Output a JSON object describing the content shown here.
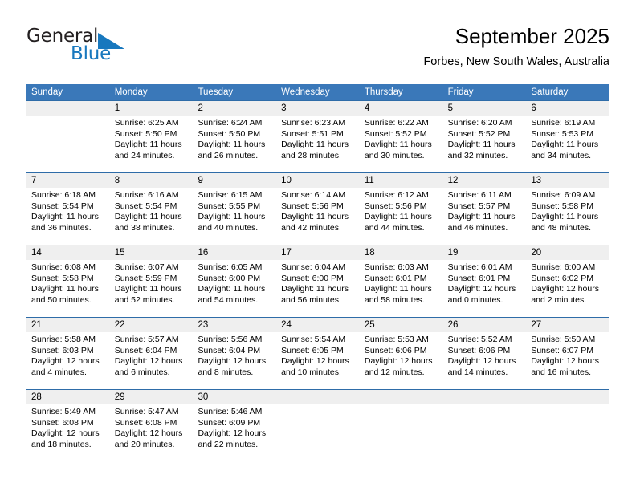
{
  "brand": {
    "name_top": "General",
    "name_bottom": "Blue",
    "accent_color": "#1878be",
    "dark_color": "#231f20"
  },
  "header": {
    "title": "September 2025",
    "subtitle": "Forbes, New South Wales, Australia"
  },
  "theme": {
    "header_blue": "#3a78b9",
    "row_rule_blue": "#2e6ca8",
    "day_band_gray": "#efefef"
  },
  "calendar": {
    "weekdays": [
      "Sunday",
      "Monday",
      "Tuesday",
      "Wednesday",
      "Thursday",
      "Friday",
      "Saturday"
    ],
    "weeks": [
      [
        {
          "day": "",
          "empty": true
        },
        {
          "day": "1",
          "sunrise": "Sunrise: 6:25 AM",
          "sunset": "Sunset: 5:50 PM",
          "daylight1": "Daylight: 11 hours",
          "daylight2": "and 24 minutes."
        },
        {
          "day": "2",
          "sunrise": "Sunrise: 6:24 AM",
          "sunset": "Sunset: 5:50 PM",
          "daylight1": "Daylight: 11 hours",
          "daylight2": "and 26 minutes."
        },
        {
          "day": "3",
          "sunrise": "Sunrise: 6:23 AM",
          "sunset": "Sunset: 5:51 PM",
          "daylight1": "Daylight: 11 hours",
          "daylight2": "and 28 minutes."
        },
        {
          "day": "4",
          "sunrise": "Sunrise: 6:22 AM",
          "sunset": "Sunset: 5:52 PM",
          "daylight1": "Daylight: 11 hours",
          "daylight2": "and 30 minutes."
        },
        {
          "day": "5",
          "sunrise": "Sunrise: 6:20 AM",
          "sunset": "Sunset: 5:52 PM",
          "daylight1": "Daylight: 11 hours",
          "daylight2": "and 32 minutes."
        },
        {
          "day": "6",
          "sunrise": "Sunrise: 6:19 AM",
          "sunset": "Sunset: 5:53 PM",
          "daylight1": "Daylight: 11 hours",
          "daylight2": "and 34 minutes."
        }
      ],
      [
        {
          "day": "7",
          "sunrise": "Sunrise: 6:18 AM",
          "sunset": "Sunset: 5:54 PM",
          "daylight1": "Daylight: 11 hours",
          "daylight2": "and 36 minutes."
        },
        {
          "day": "8",
          "sunrise": "Sunrise: 6:16 AM",
          "sunset": "Sunset: 5:54 PM",
          "daylight1": "Daylight: 11 hours",
          "daylight2": "and 38 minutes."
        },
        {
          "day": "9",
          "sunrise": "Sunrise: 6:15 AM",
          "sunset": "Sunset: 5:55 PM",
          "daylight1": "Daylight: 11 hours",
          "daylight2": "and 40 minutes."
        },
        {
          "day": "10",
          "sunrise": "Sunrise: 6:14 AM",
          "sunset": "Sunset: 5:56 PM",
          "daylight1": "Daylight: 11 hours",
          "daylight2": "and 42 minutes."
        },
        {
          "day": "11",
          "sunrise": "Sunrise: 6:12 AM",
          "sunset": "Sunset: 5:56 PM",
          "daylight1": "Daylight: 11 hours",
          "daylight2": "and 44 minutes."
        },
        {
          "day": "12",
          "sunrise": "Sunrise: 6:11 AM",
          "sunset": "Sunset: 5:57 PM",
          "daylight1": "Daylight: 11 hours",
          "daylight2": "and 46 minutes."
        },
        {
          "day": "13",
          "sunrise": "Sunrise: 6:09 AM",
          "sunset": "Sunset: 5:58 PM",
          "daylight1": "Daylight: 11 hours",
          "daylight2": "and 48 minutes."
        }
      ],
      [
        {
          "day": "14",
          "sunrise": "Sunrise: 6:08 AM",
          "sunset": "Sunset: 5:58 PM",
          "daylight1": "Daylight: 11 hours",
          "daylight2": "and 50 minutes."
        },
        {
          "day": "15",
          "sunrise": "Sunrise: 6:07 AM",
          "sunset": "Sunset: 5:59 PM",
          "daylight1": "Daylight: 11 hours",
          "daylight2": "and 52 minutes."
        },
        {
          "day": "16",
          "sunrise": "Sunrise: 6:05 AM",
          "sunset": "Sunset: 6:00 PM",
          "daylight1": "Daylight: 11 hours",
          "daylight2": "and 54 minutes."
        },
        {
          "day": "17",
          "sunrise": "Sunrise: 6:04 AM",
          "sunset": "Sunset: 6:00 PM",
          "daylight1": "Daylight: 11 hours",
          "daylight2": "and 56 minutes."
        },
        {
          "day": "18",
          "sunrise": "Sunrise: 6:03 AM",
          "sunset": "Sunset: 6:01 PM",
          "daylight1": "Daylight: 11 hours",
          "daylight2": "and 58 minutes."
        },
        {
          "day": "19",
          "sunrise": "Sunrise: 6:01 AM",
          "sunset": "Sunset: 6:01 PM",
          "daylight1": "Daylight: 12 hours",
          "daylight2": "and 0 minutes."
        },
        {
          "day": "20",
          "sunrise": "Sunrise: 6:00 AM",
          "sunset": "Sunset: 6:02 PM",
          "daylight1": "Daylight: 12 hours",
          "daylight2": "and 2 minutes."
        }
      ],
      [
        {
          "day": "21",
          "sunrise": "Sunrise: 5:58 AM",
          "sunset": "Sunset: 6:03 PM",
          "daylight1": "Daylight: 12 hours",
          "daylight2": "and 4 minutes."
        },
        {
          "day": "22",
          "sunrise": "Sunrise: 5:57 AM",
          "sunset": "Sunset: 6:04 PM",
          "daylight1": "Daylight: 12 hours",
          "daylight2": "and 6 minutes."
        },
        {
          "day": "23",
          "sunrise": "Sunrise: 5:56 AM",
          "sunset": "Sunset: 6:04 PM",
          "daylight1": "Daylight: 12 hours",
          "daylight2": "and 8 minutes."
        },
        {
          "day": "24",
          "sunrise": "Sunrise: 5:54 AM",
          "sunset": "Sunset: 6:05 PM",
          "daylight1": "Daylight: 12 hours",
          "daylight2": "and 10 minutes."
        },
        {
          "day": "25",
          "sunrise": "Sunrise: 5:53 AM",
          "sunset": "Sunset: 6:06 PM",
          "daylight1": "Daylight: 12 hours",
          "daylight2": "and 12 minutes."
        },
        {
          "day": "26",
          "sunrise": "Sunrise: 5:52 AM",
          "sunset": "Sunset: 6:06 PM",
          "daylight1": "Daylight: 12 hours",
          "daylight2": "and 14 minutes."
        },
        {
          "day": "27",
          "sunrise": "Sunrise: 5:50 AM",
          "sunset": "Sunset: 6:07 PM",
          "daylight1": "Daylight: 12 hours",
          "daylight2": "and 16 minutes."
        }
      ],
      [
        {
          "day": "28",
          "sunrise": "Sunrise: 5:49 AM",
          "sunset": "Sunset: 6:08 PM",
          "daylight1": "Daylight: 12 hours",
          "daylight2": "and 18 minutes."
        },
        {
          "day": "29",
          "sunrise": "Sunrise: 5:47 AM",
          "sunset": "Sunset: 6:08 PM",
          "daylight1": "Daylight: 12 hours",
          "daylight2": "and 20 minutes."
        },
        {
          "day": "30",
          "sunrise": "Sunrise: 5:46 AM",
          "sunset": "Sunset: 6:09 PM",
          "daylight1": "Daylight: 12 hours",
          "daylight2": "and 22 minutes."
        },
        {
          "day": "",
          "empty": true
        },
        {
          "day": "",
          "empty": true
        },
        {
          "day": "",
          "empty": true
        },
        {
          "day": "",
          "empty": true
        }
      ]
    ]
  }
}
